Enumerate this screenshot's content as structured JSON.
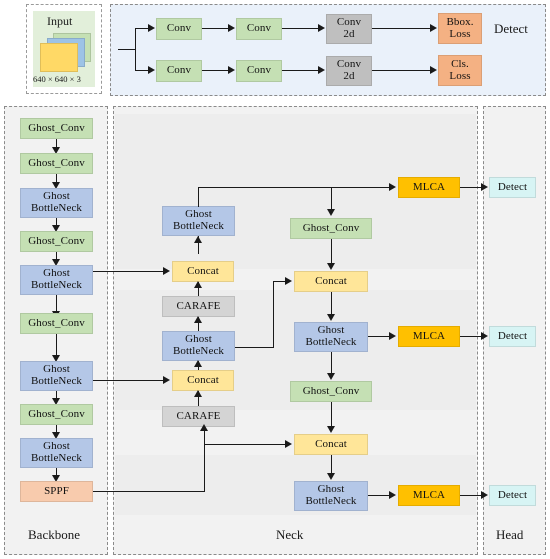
{
  "figure": {
    "type": "neural-network-architecture-diagram",
    "sections": {
      "backbone_label": "Backbone",
      "neck_label": "Neck",
      "head_label": "Head",
      "detect_label": "Detect"
    }
  },
  "input": {
    "title": "Input",
    "shape": "640 × 640 × 3"
  },
  "detect_expansion": {
    "title": "Detect",
    "branches": [
      {
        "name": "bbox-branch",
        "blocks": [
          "Conv",
          "Conv",
          "Conv\n2d",
          "Bbox.\nLoss"
        ]
      },
      {
        "name": "cls-branch",
        "blocks": [
          "Conv",
          "Conv",
          "Conv\n2d",
          "Cls.\nLoss"
        ]
      }
    ],
    "b1_conv1": "Conv",
    "b1_conv2": "Conv",
    "b1_conv2d_l1": "Conv",
    "b1_conv2d_l2": "2d",
    "b1_loss_l1": "Bbox.",
    "b1_loss_l2": "Loss",
    "b2_conv1": "Conv",
    "b2_conv2": "Conv",
    "b2_conv2d_l1": "Conv",
    "b2_conv2d_l2": "2d",
    "b2_loss_l1": "Cls.",
    "b2_loss_l2": "Loss"
  },
  "backbone": {
    "label": "Backbone",
    "blocks": [
      {
        "id": "bb1",
        "type": "Ghost_Conv",
        "l1": "Ghost_Conv"
      },
      {
        "id": "bb2",
        "type": "Ghost_Conv",
        "l1": "Ghost_Conv"
      },
      {
        "id": "bb3",
        "type": "Ghost BottleNeck",
        "l1": "Ghost",
        "l2": "BottleNeck"
      },
      {
        "id": "bb4",
        "type": "Ghost_Conv",
        "l1": "Ghost_Conv"
      },
      {
        "id": "bb5",
        "type": "Ghost BottleNeck",
        "l1": "Ghost",
        "l2": "BottleNeck"
      },
      {
        "id": "bb6",
        "type": "Ghost_Conv",
        "l1": "Ghost_Conv"
      },
      {
        "id": "bb7",
        "type": "Ghost BottleNeck",
        "l1": "Ghost",
        "l2": "BottleNeck"
      },
      {
        "id": "bb8",
        "type": "Ghost_Conv",
        "l1": "Ghost_Conv"
      },
      {
        "id": "bb9",
        "type": "Ghost BottleNeck",
        "l1": "Ghost",
        "l2": "BottleNeck"
      },
      {
        "id": "bb10",
        "type": "SPPF",
        "l1": "SPPF"
      }
    ]
  },
  "neck": {
    "label": "Neck",
    "left_column": [
      {
        "id": "nl1",
        "type": "Ghost BottleNeck",
        "l1": "Ghost",
        "l2": "BottleNeck"
      },
      {
        "id": "nl2",
        "type": "Concat",
        "l1": "Concat"
      },
      {
        "id": "nl3",
        "type": "CARAFE",
        "l1": "CARAFE"
      },
      {
        "id": "nl4",
        "type": "Ghost BottleNeck",
        "l1": "Ghost",
        "l2": "BottleNeck"
      },
      {
        "id": "nl5",
        "type": "Concat",
        "l1": "Concat"
      },
      {
        "id": "nl6",
        "type": "CARAFE",
        "l1": "CARAFE"
      }
    ],
    "right_column": [
      {
        "id": "nr1",
        "type": "Ghost_Conv",
        "l1": "Ghost_Conv"
      },
      {
        "id": "nr2",
        "type": "Concat",
        "l1": "Concat"
      },
      {
        "id": "nr3",
        "type": "Ghost BottleNeck",
        "l1": "Ghost",
        "l2": "BottleNeck"
      },
      {
        "id": "nr4",
        "type": "Ghost_Conv",
        "l1": "Ghost_Conv"
      },
      {
        "id": "nr5",
        "type": "Concat",
        "l1": "Concat"
      },
      {
        "id": "nr6",
        "type": "Ghost BottleNeck",
        "l1": "Ghost",
        "l2": "BottleNeck"
      }
    ],
    "mlca": [
      {
        "id": "mlca1",
        "label": "MLCA"
      },
      {
        "id": "mlca2",
        "label": "MLCA"
      },
      {
        "id": "mlca3",
        "label": "MLCA"
      }
    ]
  },
  "head": {
    "label": "Head",
    "detects": [
      {
        "id": "det1",
        "label": "Detect"
      },
      {
        "id": "det2",
        "label": "Detect"
      },
      {
        "id": "det3",
        "label": "Detect"
      }
    ]
  },
  "colors": {
    "ghost_conv": "#c5e0b4",
    "ghost_bottleneck": "#b4c7e7",
    "concat": "#ffe699",
    "carafe": "#d4d4d4",
    "sppf": "#f8cbad",
    "mlca": "#ffc000",
    "detect": "#d7f4f4",
    "conv2d": "#bfbfbf",
    "loss": "#f4b183",
    "panel_grey": "#f2f2f2",
    "panel_blue": "#eaf1fa",
    "arrow": "#1a1a1a"
  }
}
